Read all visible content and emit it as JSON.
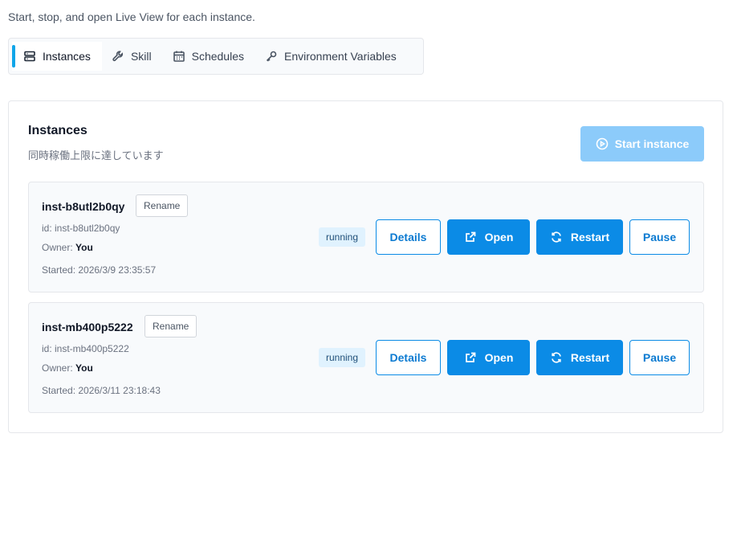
{
  "header": {
    "subtitle": "Start, stop, and open Live View for each instance."
  },
  "tabs": [
    {
      "label": "Instances",
      "icon": "server-icon",
      "active": true
    },
    {
      "label": "Skill",
      "icon": "wrench-icon",
      "active": false
    },
    {
      "label": "Schedules",
      "icon": "calendar-icon",
      "active": false
    },
    {
      "label": "Environment Variables",
      "icon": "key-icon",
      "active": false
    }
  ],
  "panel": {
    "title": "Instances",
    "subtitle": "同時稼働上限に達しています",
    "start_label": "Start instance"
  },
  "instances": [
    {
      "name": "inst-b8utl2b0qy",
      "rename_label": "Rename",
      "id_text": "id: inst-b8utl2b0qy",
      "owner_label": "Owner: ",
      "owner": "You",
      "started": "Started: 2026/3/9 23:35:57",
      "status": "running",
      "details_label": "Details",
      "open_label": "Open",
      "restart_label": "Restart",
      "pause_label": "Pause"
    },
    {
      "name": "inst-mb400p5222",
      "rename_label": "Rename",
      "id_text": "id: inst-mb400p5222",
      "owner_label": "Owner: ",
      "owner": "You",
      "started": "Started: 2026/3/11 23:18:43",
      "status": "running",
      "details_label": "Details",
      "open_label": "Open",
      "restart_label": "Restart",
      "pause_label": "Pause"
    }
  ],
  "colors": {
    "accent": "#0b8be6",
    "accent_disabled": "#8ccbfa",
    "status_bg": "#e0f2fe",
    "active_tab_bar": "#0ea5e9"
  }
}
